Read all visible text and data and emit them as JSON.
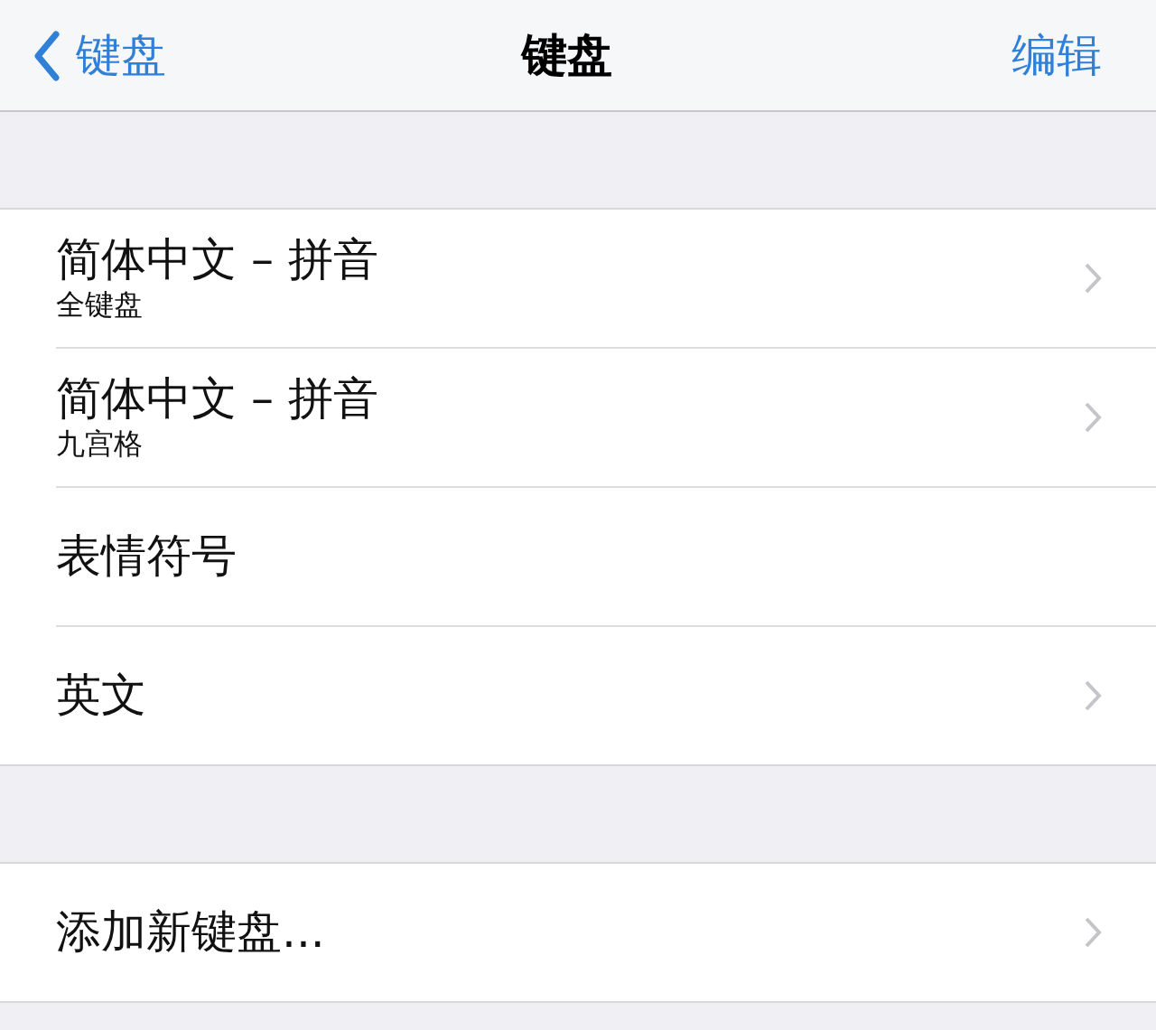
{
  "nav": {
    "back": "键盘",
    "title": "键盘",
    "action": "编辑"
  },
  "groups": [
    {
      "rows": [
        {
          "title": "简体中文 – 拼音",
          "subtitle": "全键盘",
          "chevron": true
        },
        {
          "title": "简体中文 – 拼音",
          "subtitle": "九宫格",
          "chevron": true
        },
        {
          "title": "表情符号",
          "chevron": false
        },
        {
          "title": "英文",
          "chevron": true
        }
      ]
    },
    {
      "rows": [
        {
          "title": "添加新键盘...",
          "chevron": true
        }
      ]
    }
  ]
}
